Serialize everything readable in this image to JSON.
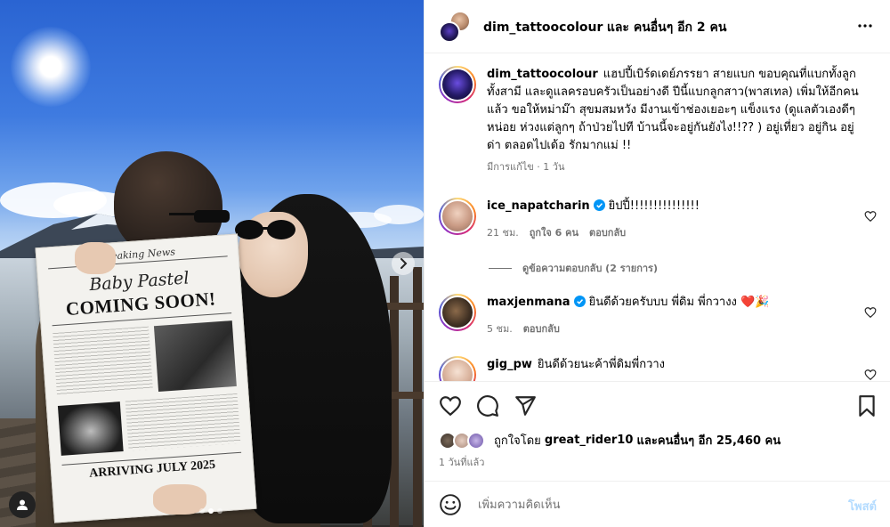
{
  "photo": {
    "newspaper": {
      "masthead": "Breaking News",
      "headline_script": "Baby Pastel",
      "headline": "COMING SOON!",
      "footer": "ARRIVING JULY 2025"
    },
    "dots_count": 3,
    "active_dot": 1
  },
  "header": {
    "username": "dim_tattoocolour",
    "and_others": "และ คนอื่นๆ อีก 2 คน",
    "more_icon": "more-horizontal-icon"
  },
  "caption": {
    "username": "dim_tattoocolour",
    "text": "แฮปปี้เบิร์ดเดย์ภรรยา สายแบก ขอบคุณที่แบกทั้งลูกทั้งสามี และดูแลครอบครัวเป็นอย่างดี ปีนี้แบกลูกสาว(พาสเทล) เพิ่มให้อีกคนแล้ว ขอให้หม่าม๊า สุขมสมหวัง มีงานเข้าช่องเยอะๆ แข็งแรง (ดูแลตัวเองดีๆหน่อย ห่วงแต่ลูกๆ ถ้าป่วยไปที บ้านนี้จะอยู่กันยังไง!!?? ) อยู่เที่ยว อยู่กิน อยู่ด่า ตลอดไปเด้อ รักมากแม่ !!",
    "edited": "มีการแก้ไข · 1 วัน"
  },
  "comments": [
    {
      "username": "ice_napatcharin",
      "verified": true,
      "text": "ยิปปี้!!!!!!!!!!!!!!!",
      "time": "21 ชม.",
      "likes": "ถูกใจ 6 คน",
      "reply": "ตอบกลับ"
    },
    {
      "username": "maxjenmana",
      "verified": true,
      "text": "ยินดีด้วยครับบบ พี่ดิม พี่กวางง ❤️🎉",
      "time": "5 ชม.",
      "reply": "ตอบกลับ"
    },
    {
      "username": "gig_pw",
      "verified": false,
      "text": "ยินดีด้วยนะค้าพี่ดิมพี่กวาง"
    }
  ],
  "view_replies": "ดูข้อความตอบกลับ (2 รายการ)",
  "likes": {
    "prefix": "ถูกใจโดย",
    "user": "great_rider10",
    "suffix": "และคนอื่นๆ อีก 25,460 คน"
  },
  "time_ago": "1 วันที่แล้ว",
  "composer": {
    "placeholder": "เพิ่มความคิดเห็น",
    "post_label": "โพสต์"
  },
  "colors": {
    "verified": "#0095f6",
    "muted": "#737373",
    "post_disabled": "#b3dbff"
  }
}
